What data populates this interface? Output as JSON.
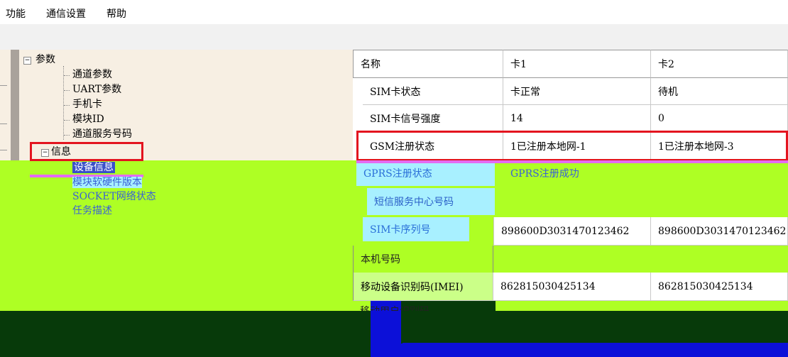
{
  "menu": {
    "items": [
      "功能",
      "通信设置",
      "帮助"
    ]
  },
  "tree": {
    "params_label": "参数",
    "params_children": [
      "通道参数",
      "UART参数",
      "手机卡",
      "模块ID",
      "通道服务号码"
    ],
    "info_label": "信息",
    "info_children": [
      "设备信息",
      "模块软硬件版本",
      "SOCKET网络状态",
      "任务描述"
    ],
    "expander_symbol": "−"
  },
  "table": {
    "headers": [
      "名称",
      "卡1",
      "卡2"
    ],
    "rows": [
      {
        "name": "SIM卡状态",
        "c1": "卡正常",
        "c2": "待机"
      },
      {
        "name": "SIM卡信号强度",
        "c1": "14",
        "c2": "0"
      },
      {
        "name": "GSM注册状态",
        "c1": "1已注册本地网-1",
        "c2": "1已注册本地网-3"
      },
      {
        "name": "GPRS注册状态",
        "c1": "GPRS注册成功",
        "c2": ""
      },
      {
        "name": "短信服务中心号码",
        "c1": "",
        "c2": ""
      },
      {
        "name": "SIM卡序列号",
        "c1": "898600D3031470123462",
        "c2": "898600D3031470123462"
      },
      {
        "name": "本机号码",
        "c1": "",
        "c2": ""
      },
      {
        "name": "移动设备识别码(IMEI)",
        "c1": "862815030425134",
        "c2": "862815030425134"
      },
      {
        "name": "移动用户识别码",
        "c1": "",
        "c2": ""
      }
    ]
  },
  "colors": {
    "highlight_red": "#e3141f",
    "highlight_pink": "#e46bf2",
    "lime": "#aeff24",
    "cyan": "#a8f0ff"
  }
}
